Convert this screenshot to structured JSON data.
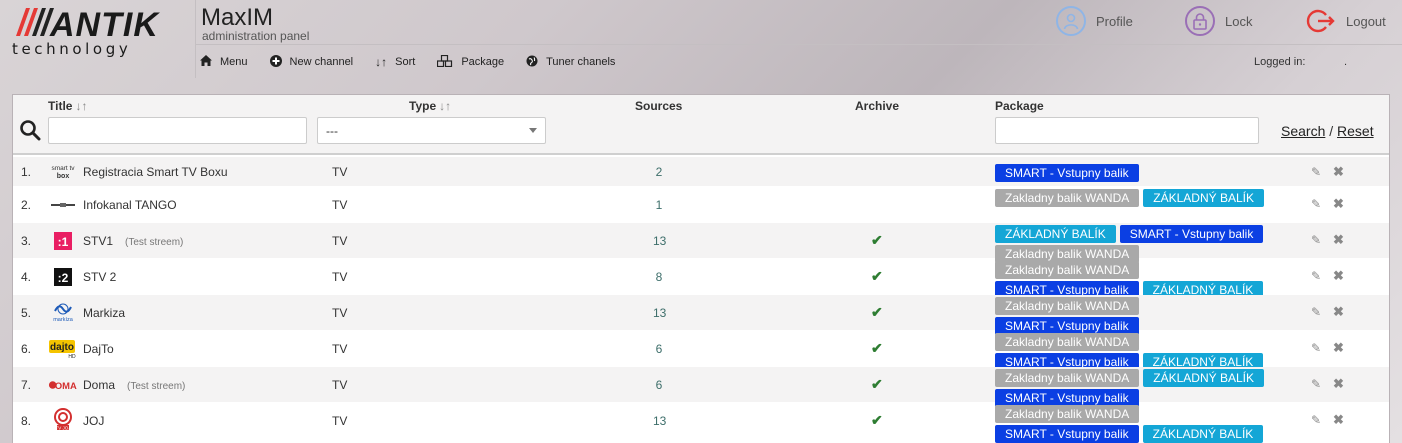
{
  "brand": {
    "logo_main": "ANTIK",
    "logo_sub": "technology",
    "app_name": "MaxIM",
    "app_subtitle": "administration panel"
  },
  "topbar": {
    "profile_label": "Profile",
    "lock_label": "Lock",
    "logout_label": "Logout",
    "logged_in_label": "Logged in:",
    "logged_in_value": "."
  },
  "nav": [
    {
      "label": "Menu",
      "icon": "home-icon"
    },
    {
      "label": "New channel",
      "icon": "plus-circle-icon"
    },
    {
      "label": "Sort",
      "icon": "sort-icon"
    },
    {
      "label": "Package",
      "icon": "boxes-icon"
    },
    {
      "label": "Tuner chanels",
      "icon": "globe-icon"
    }
  ],
  "filters": {
    "title_header": "Title",
    "type_header": "Type",
    "sources_header": "Sources",
    "archive_header": "Archive",
    "package_header": "Package",
    "title_value": "",
    "type_selected": "---",
    "package_value": "",
    "search_link": "Search",
    "separator": "/",
    "reset_link": "Reset"
  },
  "rows": [
    {
      "num": "1.",
      "logo": "smart tv box",
      "title": "Registracia Smart TV Boxu",
      "note": "",
      "type": "TV",
      "sources": "2",
      "archive": "",
      "packages": [
        {
          "label": "SMART - Vstupny balik",
          "color": "blue"
        }
      ]
    },
    {
      "num": "2.",
      "logo": "tango",
      "title": "Infokanal TANGO",
      "note": "",
      "type": "TV",
      "sources": "1",
      "archive": "",
      "packages": [
        {
          "label": "Zakladny balik WANDA",
          "color": "grey"
        },
        {
          "label": "ZÁKLADNÝ BALÍK",
          "color": "cyan"
        }
      ]
    },
    {
      "num": "3.",
      "logo": ":1",
      "title": "STV1",
      "note": "(Test streem)",
      "type": "TV",
      "sources": "13",
      "archive": "✔",
      "packages": [
        {
          "label": "ZÁKLADNÝ BALÍK",
          "color": "cyan"
        },
        {
          "label": "SMART - Vstupny balik",
          "color": "blue"
        },
        {
          "label": "Zakladny balik WANDA",
          "color": "grey"
        }
      ]
    },
    {
      "num": "4.",
      "logo": ":2",
      "title": "STV 2",
      "note": "",
      "type": "TV",
      "sources": "8",
      "archive": "✔",
      "packages": [
        {
          "label": "Zakladny balik WANDA",
          "color": "grey"
        },
        {
          "label": "SMART - Vstupny balik",
          "color": "blue"
        },
        {
          "label": "ZÁKLADNÝ BALÍK",
          "color": "cyan"
        }
      ]
    },
    {
      "num": "5.",
      "logo": "markiza",
      "title": "Markiza",
      "note": "",
      "type": "TV",
      "sources": "13",
      "archive": "✔",
      "packages": [
        {
          "label": "Zakladny balik WANDA",
          "color": "grey"
        },
        {
          "label": "SMART - Vstupny balik",
          "color": "blue"
        }
      ]
    },
    {
      "num": "6.",
      "logo": "dajto",
      "title": "DajTo",
      "note": "",
      "type": "TV",
      "sources": "6",
      "archive": "✔",
      "packages": [
        {
          "label": "Zakladny balik WANDA",
          "color": "grey"
        },
        {
          "label": "SMART - Vstupny balik",
          "color": "blue"
        },
        {
          "label": "ZÁKLADNÝ BALÍK",
          "color": "cyan"
        }
      ]
    },
    {
      "num": "7.",
      "logo": "doma",
      "title": "Doma",
      "note": "(Test streem)",
      "type": "TV",
      "sources": "6",
      "archive": "✔",
      "packages": [
        {
          "label": "Zakladny balik WANDA",
          "color": "grey"
        },
        {
          "label": "ZÁKLADNÝ BALÍK",
          "color": "cyan"
        },
        {
          "label": "SMART - Vstupny balik",
          "color": "blue"
        }
      ]
    },
    {
      "num": "8.",
      "logo": "joj",
      "title": "JOJ",
      "note": "",
      "type": "TV",
      "sources": "13",
      "archive": "✔",
      "packages": [
        {
          "label": "Zakladny balik WANDA",
          "color": "grey"
        },
        {
          "label": "SMART - Vstupny balik",
          "color": "blue"
        },
        {
          "label": "ZÁKLADNÝ BALÍK",
          "color": "cyan"
        }
      ]
    }
  ],
  "icons": {
    "edit": "✎",
    "delete": "✖"
  },
  "colors": {
    "badge_grey": "#a9a9a9",
    "badge_blue": "#0b3fe3",
    "badge_cyan": "#14a6d6",
    "check_green": "#2e7d32"
  }
}
